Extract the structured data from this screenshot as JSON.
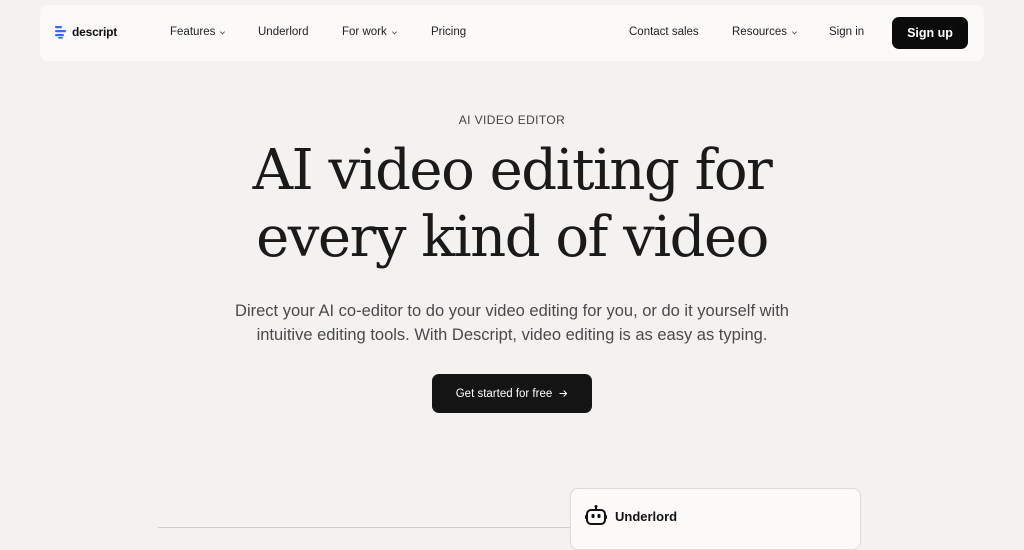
{
  "brand": {
    "name": "descript",
    "icon": "descript-logo-icon",
    "accent_color": "#3b6cff"
  },
  "nav": {
    "features": "Features",
    "underlord": "Underlord",
    "for_work": "For work",
    "pricing": "Pricing",
    "contact_sales": "Contact sales",
    "resources": "Resources",
    "sign_in": "Sign in",
    "sign_up": "Sign up"
  },
  "hero": {
    "eyebrow": "AI VIDEO EDITOR",
    "headline_line1": "AI video editing for",
    "headline_line2": "every kind of video",
    "subtext_line1": "Direct your AI co-editor to do your video editing for you, or do it yourself with",
    "subtext_line2": "intuitive editing tools. With Descript, video editing is as easy as typing.",
    "cta": "Get started for free"
  },
  "underlord_card": {
    "title": "Underlord",
    "icon": "robot-icon"
  },
  "colors": {
    "page_bg": "#f3f2f0",
    "nav_bg": "#fbfaf9",
    "button_dark": "#0b0b0b"
  }
}
